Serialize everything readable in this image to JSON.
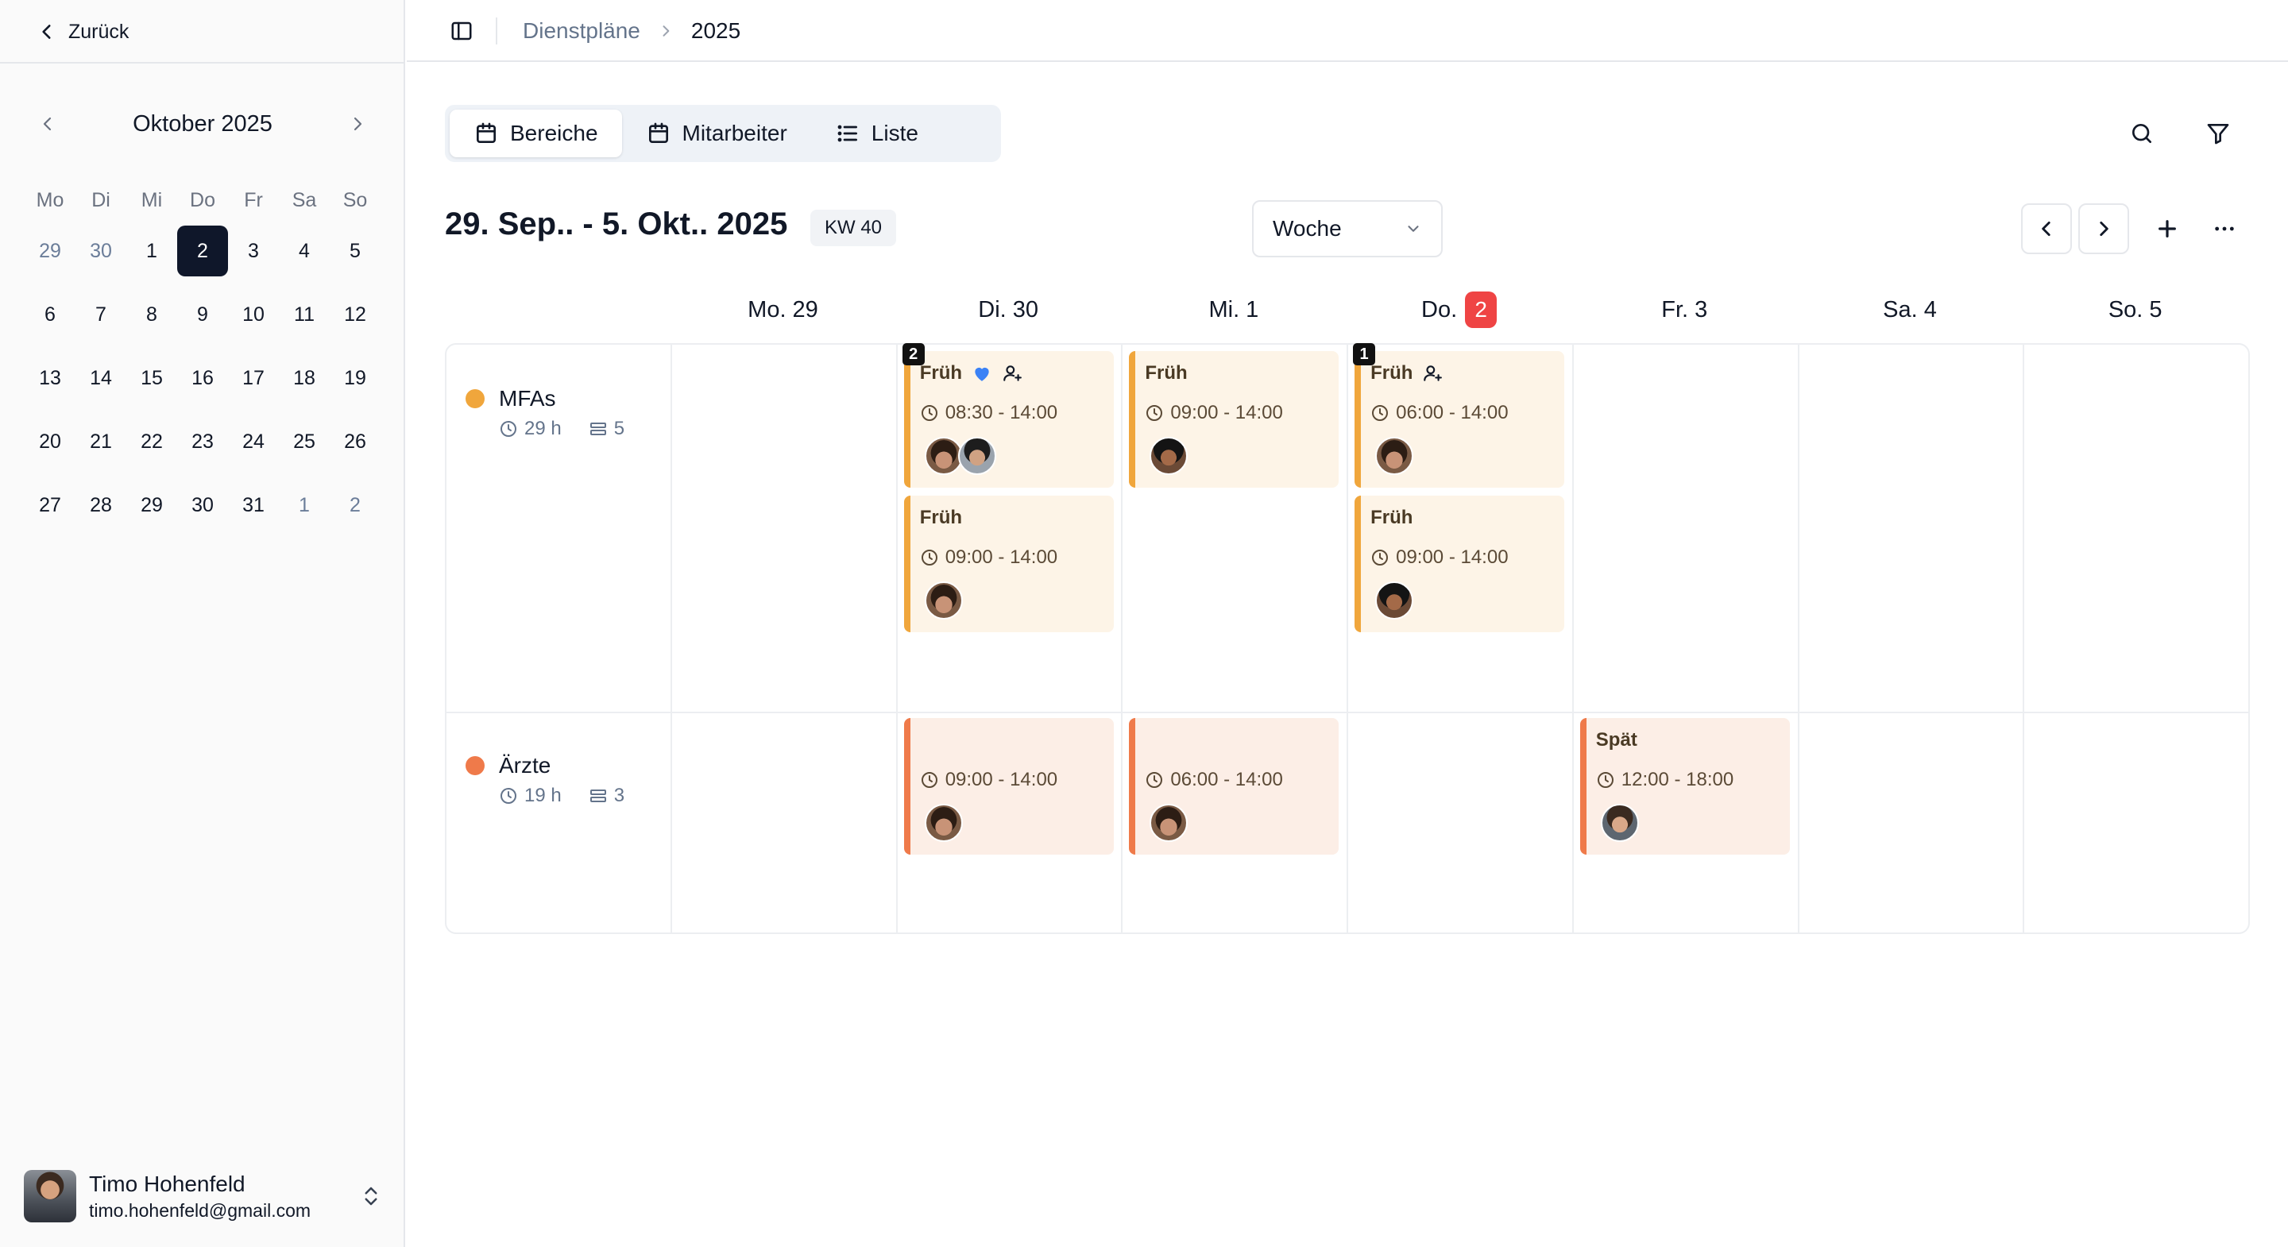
{
  "sidebar": {
    "back_label": "Zurück",
    "calendar": {
      "month_label": "Oktober 2025",
      "weekdays": [
        "Mo",
        "Di",
        "Mi",
        "Do",
        "Fr",
        "Sa",
        "So"
      ],
      "days": [
        {
          "label": "29",
          "muted": true
        },
        {
          "label": "30",
          "muted": true
        },
        {
          "label": "1"
        },
        {
          "label": "2",
          "selected": true
        },
        {
          "label": "3"
        },
        {
          "label": "4"
        },
        {
          "label": "5"
        },
        {
          "label": "6"
        },
        {
          "label": "7"
        },
        {
          "label": "8"
        },
        {
          "label": "9"
        },
        {
          "label": "10"
        },
        {
          "label": "11"
        },
        {
          "label": "12"
        },
        {
          "label": "13"
        },
        {
          "label": "14"
        },
        {
          "label": "15"
        },
        {
          "label": "16"
        },
        {
          "label": "17"
        },
        {
          "label": "18"
        },
        {
          "label": "19"
        },
        {
          "label": "20"
        },
        {
          "label": "21"
        },
        {
          "label": "22"
        },
        {
          "label": "23"
        },
        {
          "label": "24"
        },
        {
          "label": "25"
        },
        {
          "label": "26"
        },
        {
          "label": "27"
        },
        {
          "label": "28"
        },
        {
          "label": "29"
        },
        {
          "label": "30"
        },
        {
          "label": "31"
        },
        {
          "label": "1",
          "muted": true
        },
        {
          "label": "2",
          "muted": true
        }
      ]
    },
    "user": {
      "name": "Timo Hohenfeld",
      "email": "timo.hohenfeld@gmail.com"
    }
  },
  "topbar": {
    "breadcrumb_parent": "Dienstpläne",
    "breadcrumb_current": "2025"
  },
  "tabs": [
    {
      "label": "Bereiche",
      "icon": "calendar-icon",
      "active": true
    },
    {
      "label": "Mitarbeiter",
      "icon": "calendar-icon",
      "active": false
    },
    {
      "label": "Liste",
      "icon": "list-icon",
      "active": false
    }
  ],
  "week": {
    "title": "29. Sep.. - 5. Okt.. 2025",
    "kw_label": "KW 40",
    "view_select": "Woche"
  },
  "days": [
    {
      "label": "Mo. 29"
    },
    {
      "label": "Di. 30"
    },
    {
      "label": "Mi. 1"
    },
    {
      "label": "Do.",
      "badge": "2",
      "today": true
    },
    {
      "label": "Fr. 3"
    },
    {
      "label": "Sa. 4"
    },
    {
      "label": "So. 5"
    }
  ],
  "areas": [
    {
      "name": "MFAs",
      "hours": "29 h",
      "shifts": "5",
      "color": "#f0a63c"
    },
    {
      "name": "Ärzte",
      "hours": "19 h",
      "shifts": "3",
      "color": "#ef7a4a"
    }
  ],
  "shifts": [
    {
      "area": 0,
      "day": 1,
      "slot": 0,
      "title": "Früh",
      "time": "08:30 - 14:00",
      "count": "2",
      "heart": true,
      "add_person": true,
      "people": [
        "f1",
        "f2"
      ]
    },
    {
      "area": 0,
      "day": 1,
      "slot": 1,
      "title": "Früh",
      "time": "09:00 - 14:00",
      "people": [
        "f1"
      ]
    },
    {
      "area": 0,
      "day": 2,
      "slot": 0,
      "title": "Früh",
      "time": "09:00 - 14:00",
      "people": [
        "f3"
      ]
    },
    {
      "area": 0,
      "day": 3,
      "slot": 0,
      "title": "Früh",
      "time": "06:00 - 14:00",
      "count": "1",
      "add_person": true,
      "people": [
        "f1"
      ]
    },
    {
      "area": 0,
      "day": 3,
      "slot": 1,
      "title": "Früh",
      "time": "09:00 - 14:00",
      "people": [
        "f3"
      ]
    },
    {
      "area": 1,
      "day": 1,
      "slot": 0,
      "title": "",
      "time": "09:00 - 14:00",
      "people": [
        "f1"
      ]
    },
    {
      "area": 1,
      "day": 2,
      "slot": 0,
      "title": "",
      "time": "06:00 - 14:00",
      "people": [
        "f1"
      ]
    },
    {
      "area": 1,
      "day": 4,
      "slot": 0,
      "title": "Spät",
      "time": "12:00 - 18:00",
      "people": [
        "f4"
      ]
    }
  ],
  "colors": {
    "accent_orange": "#f0a63c",
    "accent_red": "#ef7a4a",
    "today_badge": "#ef4444",
    "selected_day": "#0f172a",
    "heart": "#3b82f6"
  }
}
